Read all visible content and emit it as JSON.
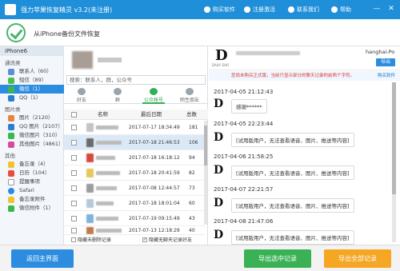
{
  "titlebar": {
    "title": "强力苹果恢复精灵 v3.2(未注册)",
    "actions": [
      {
        "label": "购买软件",
        "icon": "cart-icon"
      },
      {
        "label": "注册激活",
        "icon": "key-icon"
      },
      {
        "label": "联系我们",
        "icon": "mail-icon"
      },
      {
        "label": "帮助",
        "icon": "help-icon"
      }
    ],
    "window_buttons": {
      "minimize": "—",
      "close": "✕"
    }
  },
  "header": {
    "title": "从iPhone备份文件恢复"
  },
  "sidebar": {
    "device": "iPhone6",
    "categories": [
      {
        "name": "通讯类",
        "items": [
          {
            "label": "联系人（60）",
            "icon": "contacts-icon",
            "color": "#5a8fd8"
          },
          {
            "label": "短信（89）",
            "icon": "sms-icon",
            "color": "#4cbe4c"
          },
          {
            "label": "微信（1）",
            "icon": "wechat-icon",
            "color": "#38b948",
            "active": true
          },
          {
            "label": "QQ（1）",
            "icon": "qq-icon",
            "color": "#2a7fd4"
          }
        ]
      },
      {
        "name": "图片类",
        "items": [
          {
            "label": "图片（2120）",
            "icon": "photos-icon",
            "color": "#e8843c"
          },
          {
            "label": "QQ 图片（2107）",
            "icon": "qq-photos-icon",
            "color": "#2a7fd4"
          },
          {
            "label": "微信图片（310）",
            "icon": "wechat-photos-icon",
            "color": "#38b948"
          },
          {
            "label": "其他图片（4861）",
            "icon": "other-photos-icon",
            "color": "#d64b9b"
          }
        ]
      },
      {
        "name": "其他",
        "items": [
          {
            "label": "备忘录（4）",
            "icon": "notes-icon",
            "color": "#f2c230"
          },
          {
            "label": "日历（104）",
            "icon": "calendar-icon",
            "color": "#e74c3c"
          },
          {
            "label": "提醒事项",
            "icon": "reminders-icon",
            "color": "#ffffff"
          },
          {
            "label": "Safari",
            "icon": "safari-icon",
            "color": "#2a8be4"
          },
          {
            "label": "备忘录附件",
            "icon": "notes-attachment-icon",
            "color": "#f2c230"
          },
          {
            "label": "微信附件（1）",
            "icon": "wechat-attachment-icon",
            "color": "#38b948"
          }
        ]
      }
    ]
  },
  "middle": {
    "search_placeholder": "搜索：联系人，群，公众号",
    "tabs": [
      {
        "label": "好友",
        "icon": "person-icon"
      },
      {
        "label": "群",
        "icon": "group-icon"
      },
      {
        "label": "公众帐号",
        "icon": "official-account-icon",
        "active": true
      },
      {
        "label": "陌生朋友",
        "icon": "stranger-icon"
      }
    ],
    "columns": {
      "name": "名称",
      "date": "最后日期",
      "count": "总数"
    },
    "rows": [
      {
        "date": "2017-07-17 18:34:49",
        "count": "181",
        "avatar_color": "#c4c4c4"
      },
      {
        "date": "2017-07-18 21:46:53",
        "count": "106",
        "avatar_color": "#6a6a6a",
        "selected": true
      },
      {
        "date": "2017-07-18 16:18:12",
        "count": "94",
        "avatar_color": "#d54a3f"
      },
      {
        "date": "2017-07-18 20:41:59",
        "count": "82",
        "avatar_color": "#e5c75a"
      },
      {
        "date": "2017-07-08 12:44:57",
        "count": "73",
        "avatar_color": "#9c9c9c"
      },
      {
        "date": "2017-07-18 18:01:04",
        "count": "60",
        "avatar_color": "#b7c9d9"
      },
      {
        "date": "2017-07-19 09:15:49",
        "count": "43",
        "avatar_color": "#7fb3d8"
      },
      {
        "date": "2017-07-13 12:18:29",
        "count": "40",
        "avatar_color": "#c27a4b"
      }
    ],
    "options": {
      "hide_deleted": "隐藏未删除记录",
      "hide_no_chat": "隐藏无聊天记录好友"
    }
  },
  "chat": {
    "account_id": "hanghai-Po",
    "export_label": "导出",
    "notice": "您尚未购买正式版，当前只显示部分的聊天记录的前两个字符。",
    "notice_link": "购买软件",
    "messages": [
      {
        "time": "2017-04-05 21:12:43",
        "text": "感谢******"
      },
      {
        "time": "2017-04-05 22:23:44",
        "text": "[试用版用户，无法查看语音、图片、推送等内容]"
      },
      {
        "time": "2017-04-06 21:58:25",
        "text": "[试用版用户，无法查看语音、图片、推送等内容]"
      },
      {
        "time": "2017-04-07 22:21:57",
        "text": "[试用版用户，无法查看语音、图片、推送等内容]"
      },
      {
        "time": "2017-04-08 21:47:06",
        "text": "[试用版用户，无法查看语音、图片、推送等内容]"
      }
    ],
    "logo_letter": "D",
    "logo_caption": "DAILY DAO"
  },
  "footer": {
    "back_label": "返回主界面",
    "export_selected_label": "导出选中记录",
    "export_all_label": "导出全部记录"
  }
}
